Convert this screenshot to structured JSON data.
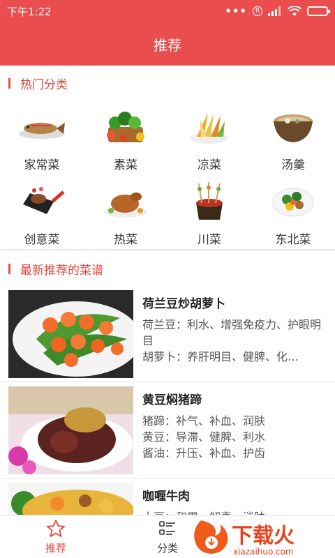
{
  "status": {
    "time": "下午1:22",
    "dots": "•••",
    "r_badge": "R"
  },
  "appbar": {
    "title": "推荐"
  },
  "hot": {
    "title": "热门分类",
    "items": [
      {
        "label": "家常菜",
        "icon": "fish-dish-icon"
      },
      {
        "label": "素菜",
        "icon": "vegetable-basket-icon"
      },
      {
        "label": "凉菜",
        "icon": "cold-salad-icon"
      },
      {
        "label": "汤羹",
        "icon": "soup-pot-icon"
      },
      {
        "label": "创意菜",
        "icon": "steak-pan-icon"
      },
      {
        "label": "热菜",
        "icon": "roast-chicken-icon"
      },
      {
        "label": "川菜",
        "icon": "skewer-pot-icon"
      },
      {
        "label": "东北菜",
        "icon": "stir-fry-plate-icon"
      }
    ]
  },
  "latest": {
    "title": "最新推荐的菜谱",
    "recipes": [
      {
        "name": "荷兰豆炒胡萝卜",
        "desc": "荷兰豆：利水、增强免疫力、护眼明目\n胡萝卜：养肝明目、健脾、化…"
      },
      {
        "name": "黄豆焖猪蹄",
        "desc": "猪蹄：补气、补血、润肤\n黄豆：导滞、健脾、利水\n酱油：升压、补血、护齿"
      },
      {
        "name": "咖喱牛肉",
        "desc": "土豆：和胃、解毒、消肿"
      }
    ]
  },
  "nav": {
    "tabs": [
      {
        "label": "推荐"
      },
      {
        "label": "分类"
      },
      {
        "label": ""
      }
    ]
  },
  "watermark": {
    "text": "下载火",
    "url": "xiazaihuo.com"
  },
  "colors": {
    "accent": "#ea4d4d",
    "title_red": "#e5453f"
  }
}
